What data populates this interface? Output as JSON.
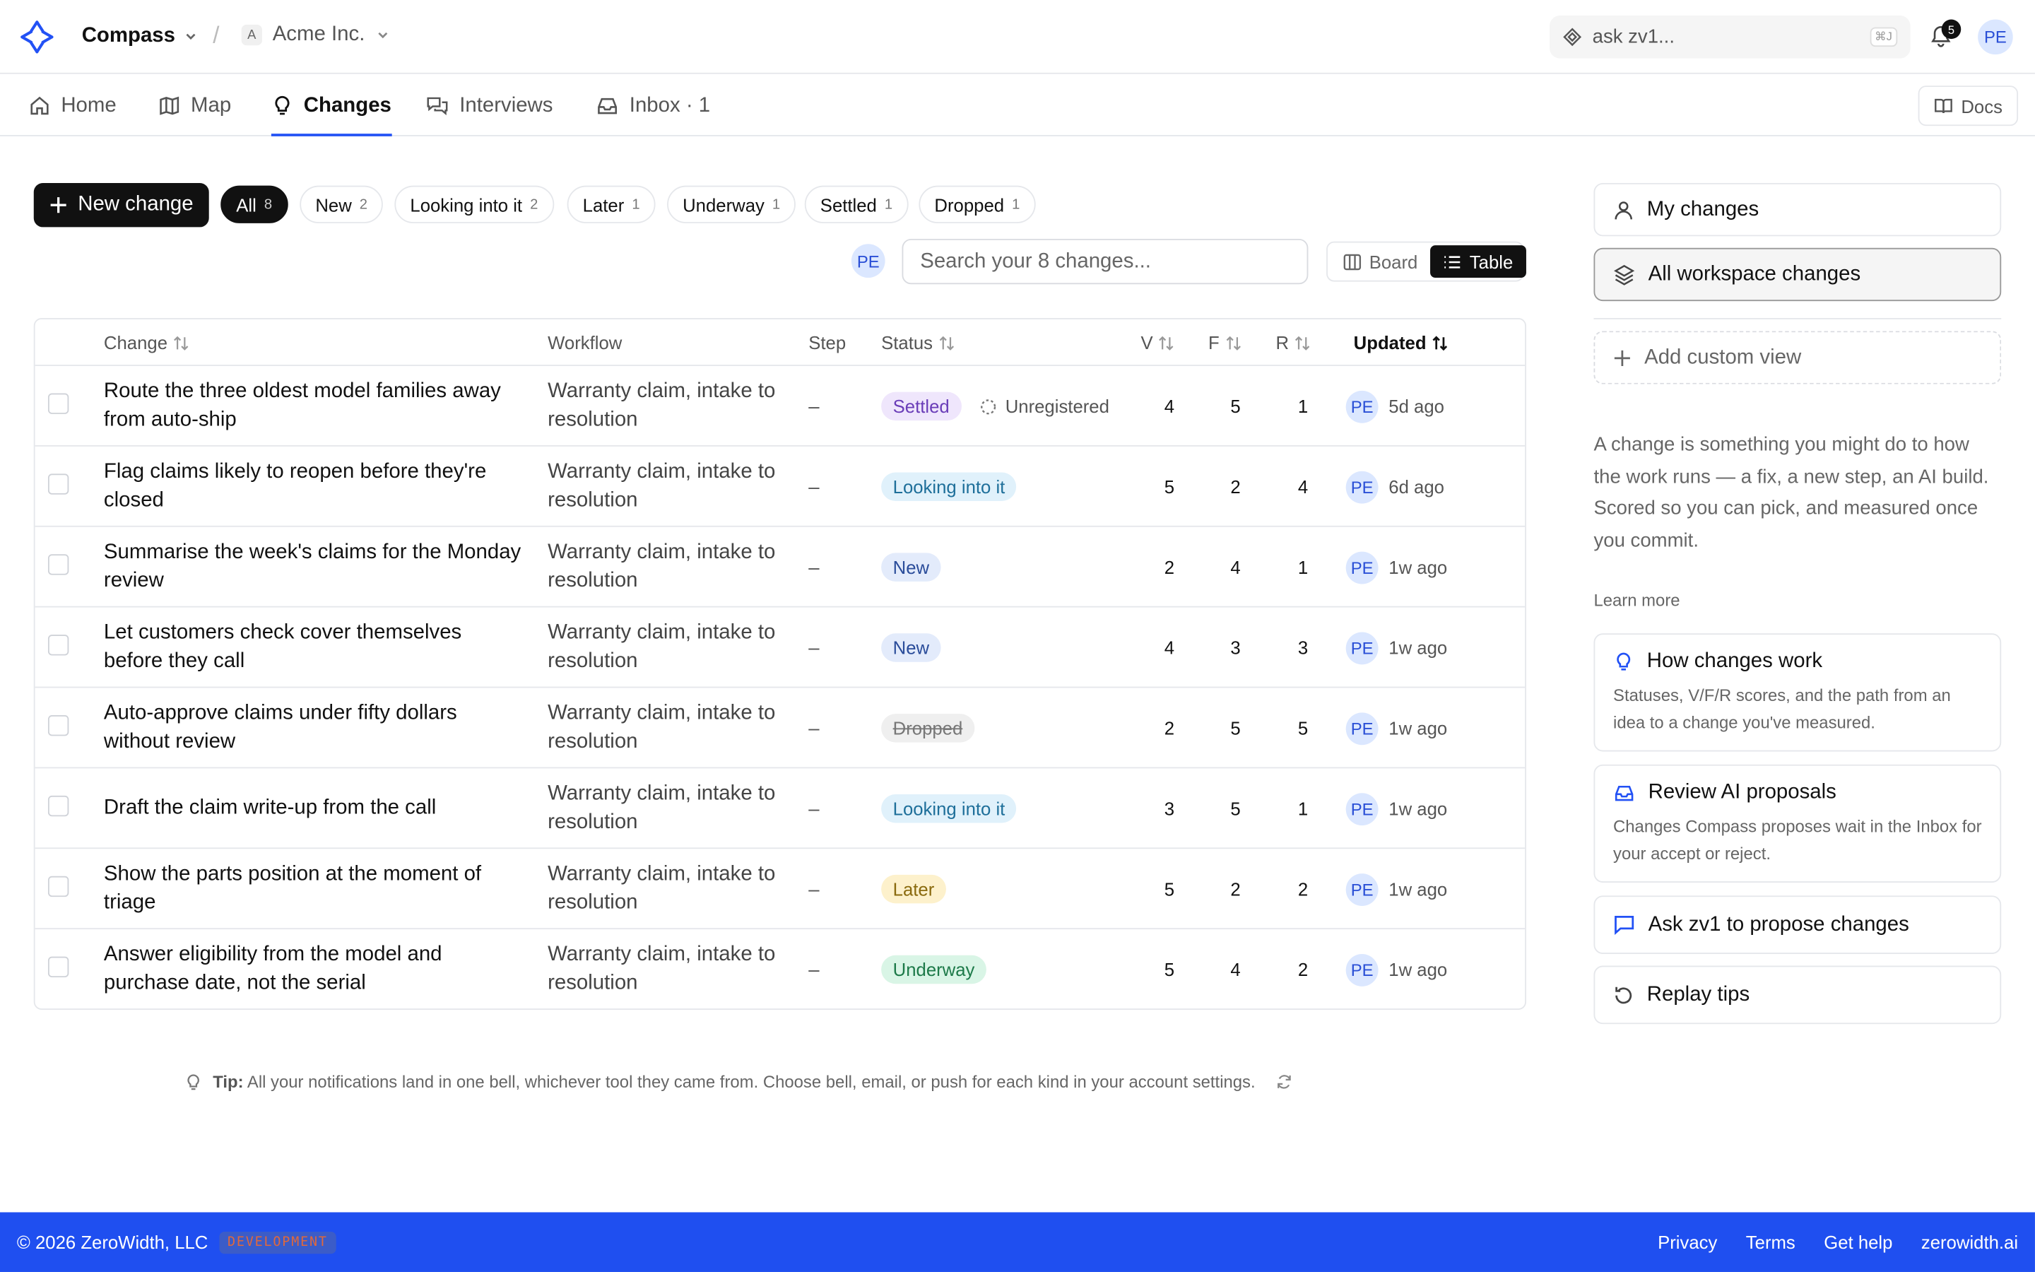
{
  "header": {
    "app_name": "Compass",
    "org_initial": "A",
    "org_name": "Acme Inc.",
    "ask_placeholder": "ask zv1...",
    "ask_shortcut": "⌘J",
    "notifications_count": "5",
    "user_initials": "PE"
  },
  "nav": {
    "tabs": [
      {
        "label": "Home",
        "icon": "home-icon"
      },
      {
        "label": "Map",
        "icon": "map-icon"
      },
      {
        "label": "Changes",
        "icon": "lightbulb-icon",
        "active": true
      },
      {
        "label": "Interviews",
        "icon": "chat-icon"
      },
      {
        "label": "Inbox · 1",
        "icon": "inbox-icon"
      }
    ],
    "docs_label": "Docs"
  },
  "toolbar": {
    "new_change_label": "New change",
    "filters": [
      {
        "label": "All",
        "count": "8",
        "active": true
      },
      {
        "label": "New",
        "count": "2"
      },
      {
        "label": "Looking into it",
        "count": "2"
      },
      {
        "label": "Later",
        "count": "1"
      },
      {
        "label": "Underway",
        "count": "1"
      },
      {
        "label": "Settled",
        "count": "1"
      },
      {
        "label": "Dropped",
        "count": "1"
      }
    ],
    "filter_avatar": "PE",
    "search_placeholder": "Search your 8 changes...",
    "view_board": "Board",
    "view_table": "Table"
  },
  "table": {
    "columns": {
      "change": "Change",
      "workflow": "Workflow",
      "step": "Step",
      "status": "Status",
      "v": "V",
      "f": "F",
      "r": "R",
      "updated": "Updated"
    },
    "rows": [
      {
        "change": "Route the three oldest model families away from auto-ship",
        "workflow": "Warranty claim, intake to resolution",
        "step": "–",
        "status": "Settled",
        "status_kind": "settled",
        "extra": "Unregistered",
        "v": "4",
        "f": "5",
        "r": "1",
        "avatar": "PE",
        "updated": "5d ago"
      },
      {
        "change": "Flag claims likely to reopen before they're closed",
        "workflow": "Warranty claim, intake to resolution",
        "step": "–",
        "status": "Looking into it",
        "status_kind": "looking",
        "v": "5",
        "f": "2",
        "r": "4",
        "avatar": "PE",
        "updated": "6d ago"
      },
      {
        "change": "Summarise the week's claims for the Monday review",
        "workflow": "Warranty claim, intake to resolution",
        "step": "–",
        "status": "New",
        "status_kind": "new",
        "v": "2",
        "f": "4",
        "r": "1",
        "avatar": "PE",
        "updated": "1w ago"
      },
      {
        "change": "Let customers check cover themselves before they call",
        "workflow": "Warranty claim, intake to resolution",
        "step": "–",
        "status": "New",
        "status_kind": "new",
        "v": "4",
        "f": "3",
        "r": "3",
        "avatar": "PE",
        "updated": "1w ago"
      },
      {
        "change": "Auto-approve claims under fifty dollars without review",
        "workflow": "Warranty claim, intake to resolution",
        "step": "–",
        "status": "Dropped",
        "status_kind": "dropped",
        "v": "2",
        "f": "5",
        "r": "5",
        "avatar": "PE",
        "updated": "1w ago"
      },
      {
        "change": "Draft the claim write-up from the call",
        "workflow": "Warranty claim, intake to resolution",
        "step": "–",
        "status": "Looking into it",
        "status_kind": "looking",
        "v": "3",
        "f": "5",
        "r": "1",
        "avatar": "PE",
        "updated": "1w ago"
      },
      {
        "change": "Show the parts position at the moment of triage",
        "workflow": "Warranty claim, intake to resolution",
        "step": "–",
        "status": "Later",
        "status_kind": "later",
        "v": "5",
        "f": "2",
        "r": "2",
        "avatar": "PE",
        "updated": "1w ago"
      },
      {
        "change": "Answer eligibility from the model and purchase date, not the serial",
        "workflow": "Warranty claim, intake to resolution",
        "step": "–",
        "status": "Underway",
        "status_kind": "underway",
        "v": "5",
        "f": "4",
        "r": "2",
        "avatar": "PE",
        "updated": "1w ago"
      }
    ]
  },
  "sidebar": {
    "my_changes": "My changes",
    "all_workspace": "All workspace changes",
    "add_view": "Add custom view",
    "description": "A change is something you might do to how the work runs — a fix, a new step, an AI build. Scored so you can pick, and measured once you commit.",
    "learn_more": "Learn more",
    "cards": [
      {
        "title": "How changes work",
        "body": "Statuses, V/F/R scores, and the path from an idea to a change you've measured."
      },
      {
        "title": "Review AI proposals",
        "body": "Changes Compass proposes wait in the Inbox for your accept or reject."
      }
    ],
    "ask_propose": "Ask zv1 to propose changes",
    "replay_tips": "Replay tips"
  },
  "tip": {
    "label": "Tip:",
    "text": "All your notifications land in one bell, whichever tool they came from. Choose bell, email, or push for each kind in your account settings."
  },
  "footer": {
    "copyright": "© 2026 ZeroWidth, LLC",
    "env_badge": "DEVELOPMENT",
    "links": [
      "Privacy",
      "Terms",
      "Get help",
      "zerowidth.ai"
    ]
  }
}
